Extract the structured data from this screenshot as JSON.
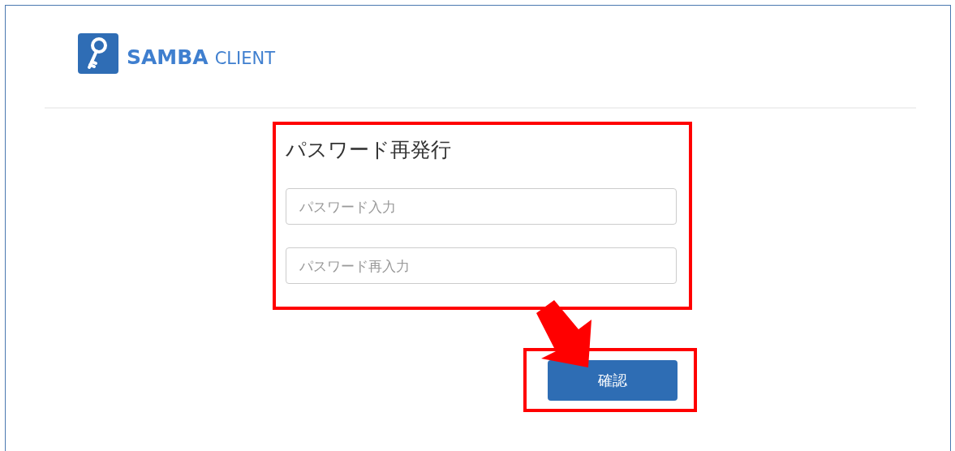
{
  "logo": {
    "name": "SAMBA",
    "suffix": "CLIENT"
  },
  "form": {
    "title": "パスワード再発行",
    "fields": [
      {
        "placeholder": "パスワード入力"
      },
      {
        "placeholder": "パスワード再入力"
      }
    ]
  },
  "buttons": [
    "確認"
  ]
}
